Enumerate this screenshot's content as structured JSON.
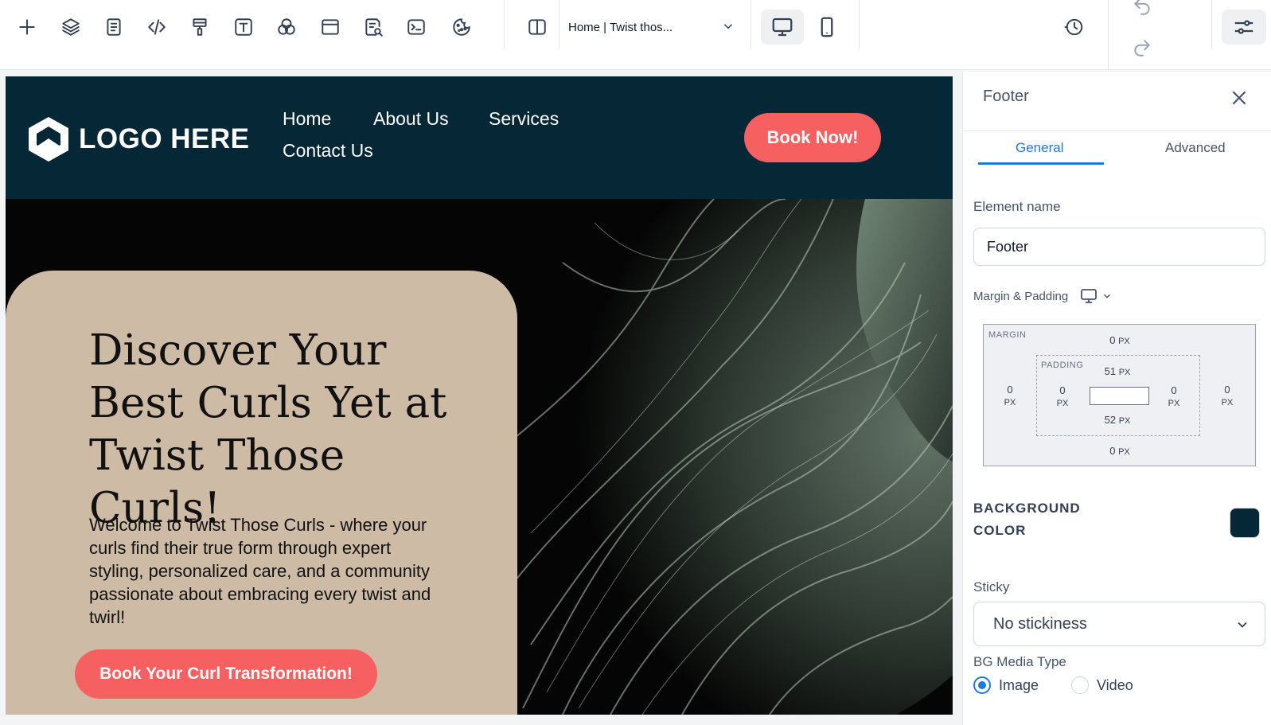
{
  "toolbar": {
    "tools": [
      "add-icon",
      "layers-icon",
      "page-icon",
      "code-icon",
      "paint-roller-icon",
      "text-icon",
      "color-palette-icon",
      "browser-window-icon",
      "seo-search-icon",
      "terminal-icon",
      "cookie-icon",
      "split-view-icon"
    ],
    "page_select_label": "Home | Twist thos...",
    "devices": [
      "desktop-icon",
      "tablet-icon"
    ],
    "active_device": "desktop"
  },
  "site": {
    "logo_text": "LOGO HERE",
    "nav": [
      "Home",
      "About Us",
      "Services",
      "Contact Us"
    ],
    "book_now_label": "Book Now!",
    "header_color": "#062735",
    "accent": "#f76060"
  },
  "hero": {
    "title": "Discover Your Best Curls Yet at Twist Those Curls!",
    "text": "Welcome to Twist Those Curls - where your curls find their true form through expert styling, personalized care, and a community passionate about embracing every twist and twirl!",
    "cta_label": "Book Your Curl Transformation!",
    "card_color": "#cdbba6"
  },
  "panel": {
    "title": "Footer",
    "tabs": [
      "General",
      "Advanced"
    ],
    "active_tab": "General",
    "element_name_label": "Element name",
    "element_name_value": "Footer",
    "margin_padding_label": "Margin & Padding",
    "box": {
      "margin_label": "MARGIN",
      "padding_label": "PADDING",
      "unit": "PX",
      "margin_top": "0",
      "margin_bottom": "0",
      "margin_left": "0",
      "margin_right": "0",
      "padding_top": "51",
      "padding_bottom": "52",
      "padding_left": "0",
      "padding_right": "0"
    },
    "bg_color_label_1": "BACKGROUND",
    "bg_color_label_2": "COLOR",
    "bg_color_value": "#062735",
    "sticky_label": "Sticky",
    "sticky_value": "No stickiness",
    "bg_media_label": "BG Media Type",
    "bg_media_options": [
      "Image",
      "Video"
    ],
    "bg_media_selected": "Image"
  }
}
